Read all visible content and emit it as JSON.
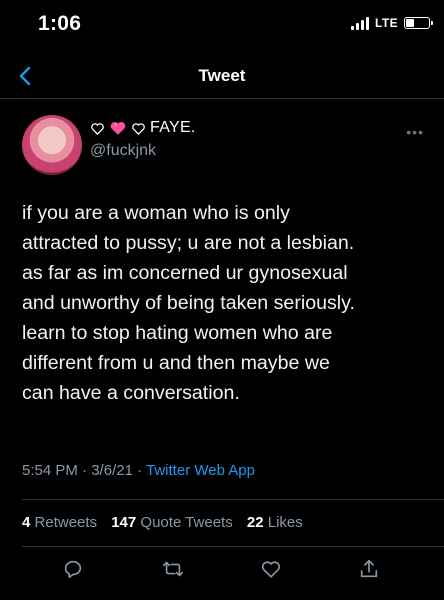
{
  "status": {
    "time": "1:06",
    "network": "LTE",
    "battery_level": 0.42
  },
  "nav": {
    "title": "Tweet"
  },
  "author": {
    "name": "FAYE.",
    "handle": "@fuckjnk"
  },
  "tweet": {
    "text": "if you are a woman who is only\nattracted to pussy; u are not a lesbian.\nas far as im concerned ur gynosexual\nand unworthy of being taken seriously.\nlearn to stop hating women who are\ndifferent from u and then maybe we\ncan have a conversation."
  },
  "meta": {
    "time": "5:54 PM",
    "date": "3/6/21",
    "sep": "·",
    "source": "Twitter Web App"
  },
  "stats": {
    "retweets": {
      "count": "4",
      "label": "Retweets"
    },
    "quotes": {
      "count": "147",
      "label": "Quote Tweets"
    },
    "likes": {
      "count": "22",
      "label": "Likes"
    }
  },
  "icons": [
    "back-chevron-icon",
    "heart-outline-icon",
    "pink-heart-icon",
    "more-icon",
    "reply-icon",
    "retweet-icon",
    "like-icon",
    "share-icon"
  ],
  "colors": {
    "accent": "#1d9bf0",
    "secondary_text": "#8b98a5",
    "divider": "#2f3336",
    "pink_heart": "#ff4fa3"
  }
}
